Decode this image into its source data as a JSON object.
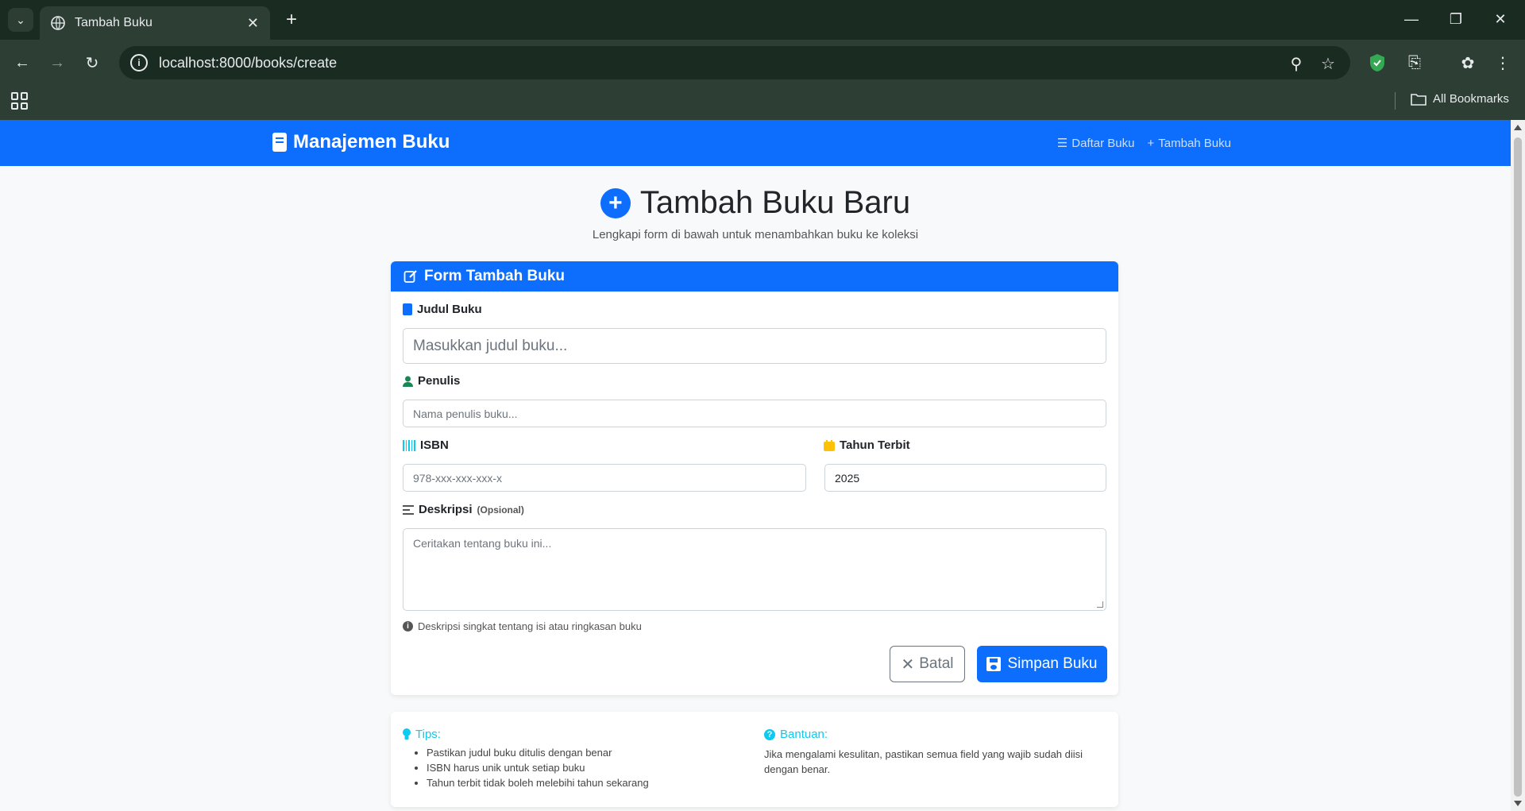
{
  "browser": {
    "tab_title": "Tambah Buku",
    "url": "localhost:8000/books/create",
    "bookmarks_label": "All Bookmarks"
  },
  "navbar": {
    "brand": "Manajemen Buku",
    "links": [
      {
        "label": "Daftar Buku",
        "icon": "list-icon"
      },
      {
        "label": "Tambah Buku",
        "icon": "plus-icon"
      }
    ]
  },
  "page": {
    "title": "Tambah Buku Baru",
    "subtitle": "Lengkapi form di bawah untuk menambahkan buku ke koleksi"
  },
  "form": {
    "header": "Form Tambah Buku",
    "title_label": "Judul Buku",
    "title_placeholder": "Masukkan judul buku...",
    "author_label": "Penulis",
    "author_placeholder": "Nama penulis buku...",
    "isbn_label": "ISBN",
    "isbn_placeholder": "978-xxx-xxx-xxx-x",
    "year_label": "Tahun Terbit",
    "year_value": "2025",
    "desc_label": "Deskripsi",
    "desc_optional": "(Opsional)",
    "desc_placeholder": "Ceritakan tentang buku ini...",
    "desc_help": "Deskripsi singkat tentang isi atau ringkasan buku",
    "cancel_label": "Batal",
    "save_label": "Simpan Buku"
  },
  "tips": {
    "heading": "Tips:",
    "items": [
      "Pastikan judul buku ditulis dengan benar",
      "ISBN harus unik untuk setiap buku",
      "Tahun terbit tidak boleh melebihi tahun sekarang"
    ],
    "help_heading": "Bantuan:",
    "help_text": "Jika mengalami kesulitan, pastikan semua field yang wajib sudah diisi dengan benar."
  },
  "colors": {
    "primary": "#0d6efd",
    "info": "#0dcaf0",
    "success": "#198754",
    "warning": "#ffc107"
  }
}
